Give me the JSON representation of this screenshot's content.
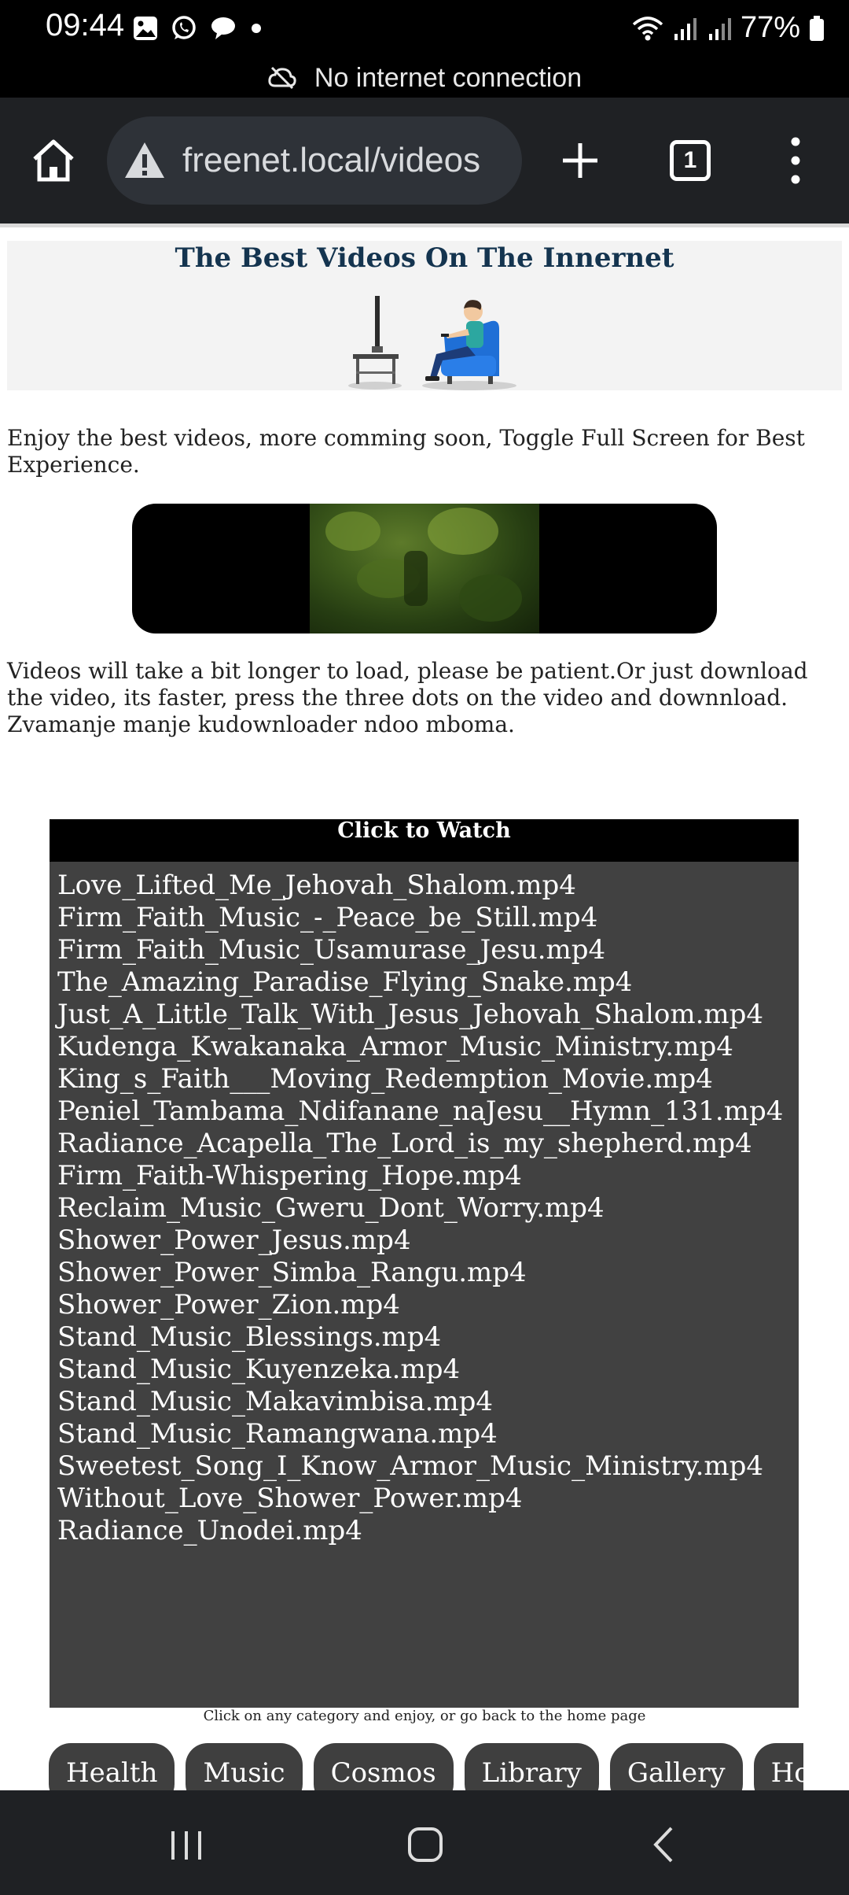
{
  "status_bar": {
    "time": "09:44",
    "battery": "77%",
    "network_notice": "No internet connection"
  },
  "browser": {
    "url": "freenet.local/videos",
    "tab_count": "1"
  },
  "page": {
    "title": "The Best Videos On The Innernet",
    "intro": "Enjoy the best videos, more comming soon, Toggle Full Screen for Best Experience.",
    "notice": "Videos will take a bit longer to load, please be patient.Or just download the video, its faster, press the three dots on the video and downnload. Zvamanje manje kudownloader ndoo mboma.",
    "list_header": "Click to Watch",
    "videos": [
      "Love_Lifted_Me_Jehovah_Shalom.mp4",
      "Firm_Faith_Music_-_Peace_be_Still.mp4",
      "Firm_Faith_Music_Usamurase_Jesu.mp4",
      "The_Amazing_Paradise_Flying_Snake.mp4",
      "Just_A_Little_Talk_With_Jesus_Jehovah_Shalom.mp4",
      "Kudenga_Kwakanaka_Armor_Music_Ministry.mp4",
      "King_s_Faith___Moving_Redemption_Movie.mp4",
      "Peniel_Tambama_Ndifanane_naJesu__Hymn_131.mp4",
      "Radiance_Acapella_The_Lord_is_my_shepherd.mp4",
      "Firm_Faith-Whispering_Hope.mp4",
      "Reclaim_Music_Gweru_Dont_Worry.mp4",
      "Shower_Power_Jesus.mp4",
      "Shower_Power_Simba_Rangu.mp4",
      "Shower_Power_Zion.mp4",
      "Stand_Music_Blessings.mp4",
      "Stand_Music_Kuyenzeka.mp4",
      "Stand_Music_Makavimbisa.mp4",
      "Stand_Music_Ramangwana.mp4",
      "Sweetest_Song_I_Know_Armor_Music_Ministry.mp4",
      "Without_Love_Shower_Power.mp4",
      "Radiance_Unodei.mp4"
    ],
    "footnote": "Click on any category and enjoy, or go back to the home page",
    "categories": [
      "Health",
      "Music",
      "Cosmos",
      "Library",
      "Gallery",
      "Home"
    ]
  },
  "colors": {
    "title": "#14344f",
    "list_bg": "#414141",
    "toolbar_bg": "#1f2124"
  }
}
